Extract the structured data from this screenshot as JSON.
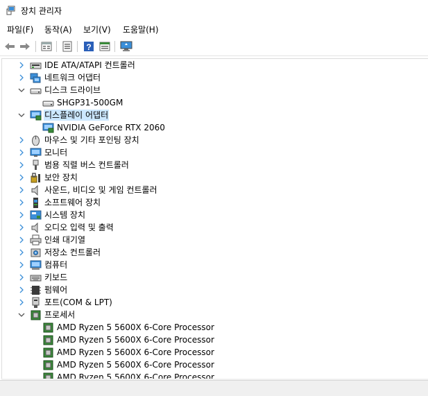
{
  "window": {
    "title": "장치 관리자"
  },
  "menu": [
    "파일(F)",
    "동작(A)",
    "보기(V)",
    "도움말(H)"
  ],
  "toolbar": {
    "buttons": [
      "back-icon",
      "forward-icon",
      "properties-icon",
      "show-hide-tree-icon",
      "help-icon",
      "view-icon",
      "scan-hardware-icon"
    ]
  },
  "tree": [
    {
      "label": "IDE ATA/ATAPI 컨트롤러",
      "level": 1,
      "expander": "collapsed",
      "icon": "ide-controller-icon"
    },
    {
      "label": "네트워크 어댑터",
      "level": 1,
      "expander": "collapsed",
      "icon": "network-adapter-icon"
    },
    {
      "label": "디스크 드라이브",
      "level": 1,
      "expander": "expanded",
      "icon": "disk-drive-icon"
    },
    {
      "label": "SHGP31-500GM",
      "level": 2,
      "expander": "none",
      "icon": "disk-drive-icon"
    },
    {
      "label": "디스플레이 어댑터",
      "level": 1,
      "expander": "expanded",
      "icon": "display-adapter-icon",
      "selected": true
    },
    {
      "label": "NVIDIA GeForce RTX 2060",
      "level": 2,
      "expander": "none",
      "icon": "display-adapter-icon"
    },
    {
      "label": "마우스 및 기타 포인팅 장치",
      "level": 1,
      "expander": "collapsed",
      "icon": "mouse-icon"
    },
    {
      "label": "모니터",
      "level": 1,
      "expander": "collapsed",
      "icon": "monitor-icon"
    },
    {
      "label": "범용 직렬 버스 컨트롤러",
      "level": 1,
      "expander": "collapsed",
      "icon": "usb-icon"
    },
    {
      "label": "보안 장치",
      "level": 1,
      "expander": "collapsed",
      "icon": "security-device-icon"
    },
    {
      "label": "사운드, 비디오 및 게임 컨트롤러",
      "level": 1,
      "expander": "collapsed",
      "icon": "speaker-icon"
    },
    {
      "label": "소프트웨어 장치",
      "level": 1,
      "expander": "collapsed",
      "icon": "software-device-icon"
    },
    {
      "label": "시스템 장치",
      "level": 1,
      "expander": "collapsed",
      "icon": "system-device-icon"
    },
    {
      "label": "오디오 입력 및 출력",
      "level": 1,
      "expander": "collapsed",
      "icon": "speaker-icon"
    },
    {
      "label": "인쇄 대기열",
      "level": 1,
      "expander": "collapsed",
      "icon": "printer-icon"
    },
    {
      "label": "저장소 컨트롤러",
      "level": 1,
      "expander": "collapsed",
      "icon": "storage-controller-icon"
    },
    {
      "label": "컴퓨터",
      "level": 1,
      "expander": "collapsed",
      "icon": "computer-icon"
    },
    {
      "label": "키보드",
      "level": 1,
      "expander": "collapsed",
      "icon": "keyboard-icon"
    },
    {
      "label": "펌웨어",
      "level": 1,
      "expander": "collapsed",
      "icon": "firmware-icon"
    },
    {
      "label": "포트(COM & LPT)",
      "level": 1,
      "expander": "collapsed",
      "icon": "port-icon"
    },
    {
      "label": "프로세서",
      "level": 1,
      "expander": "expanded",
      "icon": "processor-icon"
    },
    {
      "label": "AMD Ryzen 5 5600X 6-Core Processor",
      "level": 2,
      "expander": "none",
      "icon": "processor-icon"
    },
    {
      "label": "AMD Ryzen 5 5600X 6-Core Processor",
      "level": 2,
      "expander": "none",
      "icon": "processor-icon"
    },
    {
      "label": "AMD Ryzen 5 5600X 6-Core Processor",
      "level": 2,
      "expander": "none",
      "icon": "processor-icon"
    },
    {
      "label": "AMD Ryzen 5 5600X 6-Core Processor",
      "level": 2,
      "expander": "none",
      "icon": "processor-icon"
    },
    {
      "label": "AMD Ryzen 5 5600X 6-Core Processor",
      "level": 2,
      "expander": "none",
      "icon": "processor-icon"
    }
  ],
  "colors": {
    "selection": "#cce8ff",
    "accent": "#0078d7"
  }
}
